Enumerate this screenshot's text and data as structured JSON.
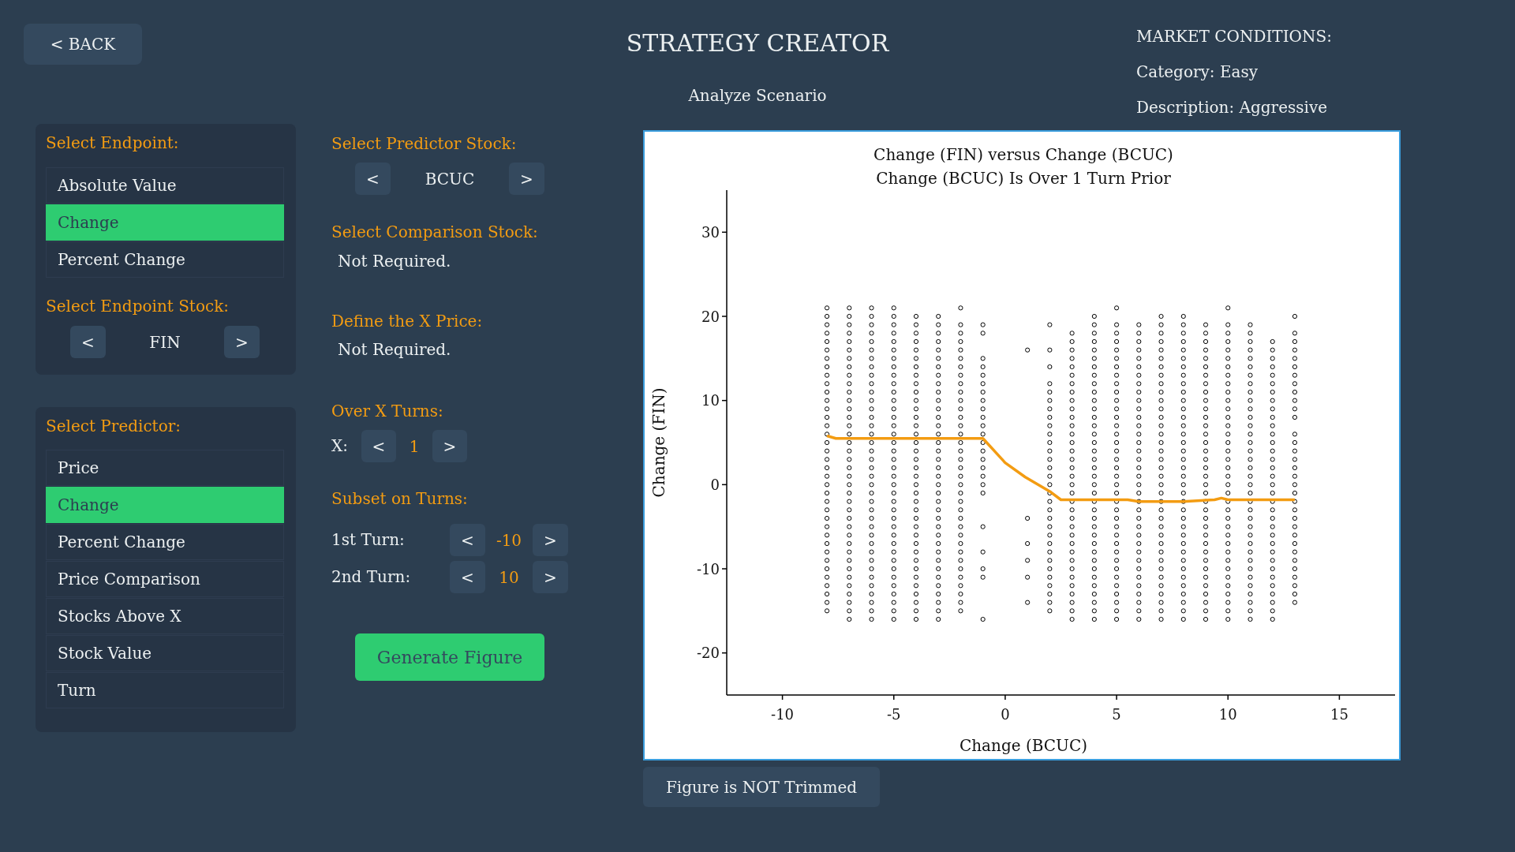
{
  "back_button": "< BACK",
  "header": {
    "title": "STRATEGY CREATOR",
    "subtitle": "Analyze Scenario"
  },
  "market_conditions": {
    "heading": "MARKET CONDITIONS:",
    "category": "Category: Easy",
    "description": "Description: Aggressive"
  },
  "endpoint_panel": {
    "heading": "Select Endpoint:",
    "options": [
      {
        "label": "Absolute Value",
        "selected": false
      },
      {
        "label": "Change",
        "selected": true
      },
      {
        "label": "Percent Change",
        "selected": false
      }
    ],
    "stock_heading": "Select Endpoint Stock:",
    "stock_stepper": {
      "prev": "<",
      "value": "FIN",
      "next": ">"
    }
  },
  "predictor_panel": {
    "heading": "Select Predictor:",
    "options": [
      {
        "label": "Price",
        "selected": false
      },
      {
        "label": "Change",
        "selected": true
      },
      {
        "label": "Percent Change",
        "selected": false
      },
      {
        "label": "Price Comparison",
        "selected": false
      },
      {
        "label": "Stocks Above X",
        "selected": false
      },
      {
        "label": "Stock Value",
        "selected": false
      },
      {
        "label": "Turn",
        "selected": false
      }
    ]
  },
  "predictor_stock": {
    "heading": "Select Predictor Stock:",
    "stepper": {
      "prev": "<",
      "value": "BCUC",
      "next": ">"
    }
  },
  "comparison_stock": {
    "heading": "Select Comparison Stock:",
    "note": "Not Required."
  },
  "x_price": {
    "heading": "Define the X Price:",
    "note": "Not Required."
  },
  "over_x_turns": {
    "heading": "Over X Turns:",
    "label": "X:",
    "stepper": {
      "prev": "<",
      "value": "1",
      "next": ">"
    }
  },
  "subset_on_turns": {
    "heading": "Subset on Turns:",
    "rows": [
      {
        "label": "1st Turn:",
        "stepper": {
          "prev": "<",
          "value": "-10",
          "next": ">"
        }
      },
      {
        "label": "2nd Turn:",
        "stepper": {
          "prev": "<",
          "value": "10",
          "next": ">"
        }
      }
    ]
  },
  "generate_button": "Generate Figure",
  "figure": {
    "chart_data": {
      "type": "scatter",
      "title": "Change (FIN) versus Change (BCUC)",
      "subtitle": "Change (BCUC) Is Over 1 Turn Prior",
      "xlabel": "Change (BCUC)",
      "ylabel": "Change (FIN)",
      "xlim": [
        -12.5,
        17.5
      ],
      "ylim": [
        -25,
        35
      ],
      "xticks": [
        -10,
        -5,
        0,
        5,
        10,
        15
      ],
      "yticks": [
        -20,
        -10,
        0,
        10,
        20,
        30
      ],
      "series": [
        {
          "type": "scatter",
          "color": "#000000",
          "x": [
            -8,
            -8,
            -8,
            -8,
            -8,
            -8,
            -8,
            -8,
            -8,
            -8,
            -8,
            -8,
            -8,
            -8,
            -8,
            -8,
            -8,
            -8,
            -8,
            -8,
            -8,
            -8,
            -8,
            -8,
            -8,
            -8,
            -8,
            -8,
            -8,
            -8,
            -8,
            -8,
            -8,
            -8,
            -8,
            -8,
            -8,
            -7,
            -7,
            -7,
            -7,
            -7,
            -7,
            -7,
            -7,
            -7,
            -7,
            -7,
            -7,
            -7,
            -7,
            -7,
            -7,
            -7,
            -7,
            -7,
            -7,
            -7,
            -7,
            -7,
            -7,
            -7,
            -7,
            -7,
            -7,
            -7,
            -7,
            -7,
            -7,
            -7,
            -7,
            -7,
            -7,
            -7,
            -7,
            -6,
            -6,
            -6,
            -6,
            -6,
            -6,
            -6,
            -6,
            -6,
            -6,
            -6,
            -6,
            -6,
            -6,
            -6,
            -6,
            -6,
            -6,
            -6,
            -6,
            -6,
            -6,
            -6,
            -6,
            -6,
            -6,
            -6,
            -6,
            -6,
            -6,
            -6,
            -6,
            -6,
            -6,
            -6,
            -6,
            -6,
            -6,
            -5,
            -5,
            -5,
            -5,
            -5,
            -5,
            -5,
            -5,
            -5,
            -5,
            -5,
            -5,
            -5,
            -5,
            -5,
            -5,
            -5,
            -5,
            -5,
            -5,
            -5,
            -5,
            -5,
            -5,
            -5,
            -5,
            -5,
            -5,
            -5,
            -5,
            -5,
            -5,
            -5,
            -5,
            -5,
            -5,
            -5,
            -5,
            -4,
            -4,
            -4,
            -4,
            -4,
            -4,
            -4,
            -4,
            -4,
            -4,
            -4,
            -4,
            -4,
            -4,
            -4,
            -4,
            -4,
            -4,
            -4,
            -4,
            -4,
            -4,
            -4,
            -4,
            -4,
            -4,
            -4,
            -4,
            -4,
            -4,
            -4,
            -4,
            -4,
            -4,
            -4,
            -4,
            -4,
            -3,
            -3,
            -3,
            -3,
            -3,
            -3,
            -3,
            -3,
            -3,
            -3,
            -3,
            -3,
            -3,
            -3,
            -3,
            -3,
            -3,
            -3,
            -3,
            -3,
            -3,
            -3,
            -3,
            -3,
            -3,
            -3,
            -3,
            -3,
            -3,
            -3,
            -3,
            -3,
            -3,
            -3,
            -3,
            -3,
            -3,
            -2,
            -2,
            -2,
            -2,
            -2,
            -2,
            -2,
            -2,
            -2,
            -2,
            -2,
            -2,
            -2,
            -2,
            -2,
            -2,
            -2,
            -2,
            -2,
            -2,
            -2,
            -2,
            -2,
            -2,
            -2,
            -2,
            -2,
            -2,
            -2,
            -2,
            -2,
            -2,
            -2,
            -2,
            -2,
            -2,
            -1,
            -1,
            -1,
            -1,
            -1,
            -1,
            -1,
            -1,
            -1,
            -1,
            -1,
            -1,
            -1,
            -1,
            -1,
            -1,
            -1,
            -1,
            -1,
            -1,
            -1,
            -1,
            -1,
            -1,
            1,
            1,
            1,
            1,
            1,
            1,
            2,
            2,
            2,
            2,
            2,
            2,
            2,
            2,
            2,
            2,
            2,
            2,
            2,
            2,
            2,
            2,
            2,
            2,
            2,
            2,
            2,
            2,
            2,
            2,
            2,
            2,
            2,
            2,
            2,
            2,
            2,
            3,
            3,
            3,
            3,
            3,
            3,
            3,
            3,
            3,
            3,
            3,
            3,
            3,
            3,
            3,
            3,
            3,
            3,
            3,
            3,
            3,
            3,
            3,
            3,
            3,
            3,
            3,
            3,
            3,
            3,
            3,
            3,
            3,
            3,
            3,
            4,
            4,
            4,
            4,
            4,
            4,
            4,
            4,
            4,
            4,
            4,
            4,
            4,
            4,
            4,
            4,
            4,
            4,
            4,
            4,
            4,
            4,
            4,
            4,
            4,
            4,
            4,
            4,
            4,
            4,
            4,
            4,
            4,
            4,
            4,
            4,
            4,
            5,
            5,
            5,
            5,
            5,
            5,
            5,
            5,
            5,
            5,
            5,
            5,
            5,
            5,
            5,
            5,
            5,
            5,
            5,
            5,
            5,
            5,
            5,
            5,
            5,
            5,
            5,
            5,
            5,
            5,
            5,
            5,
            5,
            5,
            5,
            5,
            5,
            6,
            6,
            6,
            6,
            6,
            6,
            6,
            6,
            6,
            6,
            6,
            6,
            6,
            6,
            6,
            6,
            6,
            6,
            6,
            6,
            6,
            6,
            6,
            6,
            6,
            6,
            6,
            6,
            6,
            6,
            6,
            6,
            6,
            6,
            6,
            6,
            7,
            7,
            7,
            7,
            7,
            7,
            7,
            7,
            7,
            7,
            7,
            7,
            7,
            7,
            7,
            7,
            7,
            7,
            7,
            7,
            7,
            7,
            7,
            7,
            7,
            7,
            7,
            7,
            7,
            7,
            7,
            7,
            7,
            7,
            7,
            7,
            7,
            8,
            8,
            8,
            8,
            8,
            8,
            8,
            8,
            8,
            8,
            8,
            8,
            8,
            8,
            8,
            8,
            8,
            8,
            8,
            8,
            8,
            8,
            8,
            8,
            8,
            8,
            8,
            8,
            8,
            8,
            8,
            8,
            8,
            8,
            8,
            8,
            8,
            9,
            9,
            9,
            9,
            9,
            9,
            9,
            9,
            9,
            9,
            9,
            9,
            9,
            9,
            9,
            9,
            9,
            9,
            9,
            9,
            9,
            9,
            9,
            9,
            9,
            9,
            9,
            9,
            9,
            9,
            9,
            9,
            9,
            9,
            9,
            9,
            10,
            10,
            10,
            10,
            10,
            10,
            10,
            10,
            10,
            10,
            10,
            10,
            10,
            10,
            10,
            10,
            10,
            10,
            10,
            10,
            10,
            10,
            10,
            10,
            10,
            10,
            10,
            10,
            10,
            10,
            10,
            10,
            10,
            10,
            10,
            10,
            10,
            11,
            11,
            11,
            11,
            11,
            11,
            11,
            11,
            11,
            11,
            11,
            11,
            11,
            11,
            11,
            11,
            11,
            11,
            11,
            11,
            11,
            11,
            11,
            11,
            11,
            11,
            11,
            11,
            11,
            11,
            11,
            11,
            11,
            11,
            11,
            11,
            12,
            12,
            12,
            12,
            12,
            12,
            12,
            12,
            12,
            12,
            12,
            12,
            12,
            12,
            12,
            12,
            12,
            12,
            12,
            12,
            12,
            12,
            12,
            12,
            12,
            12,
            12,
            12,
            12,
            12,
            12,
            12,
            12,
            12,
            13,
            13,
            13,
            13,
            13,
            13,
            13,
            13,
            13,
            13,
            13,
            13,
            13,
            13,
            13,
            13,
            13,
            13,
            13,
            13,
            13,
            13,
            13,
            13,
            13,
            13,
            13,
            13,
            13,
            13,
            13,
            13,
            13
          ],
          "values": [
            21,
            20,
            19,
            18,
            17,
            16,
            15,
            14,
            13,
            12,
            11,
            10,
            9,
            8,
            7,
            6,
            5,
            4,
            3,
            2,
            1,
            0,
            -1,
            -2,
            -3,
            -4,
            -5,
            -6,
            -7,
            -8,
            -9,
            -10,
            -11,
            -12,
            -13,
            -14,
            -15,
            21,
            20,
            19,
            18,
            17,
            16,
            15,
            14,
            13,
            12,
            11,
            10,
            9,
            8,
            7,
            6,
            5,
            4,
            3,
            2,
            1,
            0,
            -1,
            -2,
            -3,
            -4,
            -5,
            -6,
            -7,
            -8,
            -9,
            -10,
            -11,
            -12,
            -13,
            -14,
            -15,
            -16,
            21,
            20,
            19,
            18,
            17,
            16,
            15,
            14,
            13,
            12,
            11,
            10,
            9,
            8,
            7,
            6,
            5,
            4,
            3,
            2,
            1,
            0,
            -1,
            -2,
            -3,
            -4,
            -5,
            -6,
            -7,
            -8,
            -9,
            -10,
            -11,
            -12,
            -13,
            -14,
            -15,
            -16,
            21,
            20,
            19,
            18,
            17,
            16,
            15,
            14,
            13,
            12,
            11,
            10,
            9,
            8,
            7,
            6,
            5,
            4,
            3,
            2,
            1,
            0,
            -1,
            -2,
            -3,
            -4,
            -5,
            -6,
            -7,
            -8,
            -9,
            -10,
            -11,
            -12,
            -13,
            -14,
            -15,
            -16,
            20,
            19,
            18,
            17,
            16,
            15,
            14,
            13,
            12,
            11,
            10,
            9,
            8,
            7,
            6,
            5,
            4,
            3,
            2,
            1,
            0,
            -1,
            -2,
            -3,
            -4,
            -5,
            -6,
            -7,
            -8,
            -9,
            -10,
            -11,
            -12,
            -13,
            -14,
            -15,
            -16,
            20,
            19,
            18,
            17,
            16,
            15,
            14,
            13,
            12,
            11,
            10,
            9,
            8,
            7,
            6,
            5,
            4,
            3,
            2,
            1,
            0,
            -1,
            -2,
            -3,
            -4,
            -5,
            -6,
            -7,
            -8,
            -9,
            -10,
            -11,
            -12,
            -13,
            -14,
            -15,
            -16,
            21,
            19,
            18,
            17,
            16,
            15,
            14,
            13,
            12,
            11,
            10,
            9,
            8,
            7,
            6,
            5,
            4,
            3,
            2,
            1,
            0,
            -1,
            -2,
            -3,
            -4,
            -5,
            -6,
            -7,
            -8,
            -9,
            -10,
            -11,
            -12,
            -13,
            -14,
            -15,
            19,
            18,
            15,
            14,
            13,
            12,
            11,
            10,
            9,
            8,
            7,
            6,
            5,
            4,
            3,
            2,
            1,
            0,
            -1,
            -5,
            -8,
            -10,
            -11,
            -16,
            16,
            -4,
            -7,
            -9,
            -11,
            -14,
            19,
            16,
            14,
            12,
            11,
            10,
            9,
            8,
            7,
            6,
            5,
            4,
            3,
            2,
            1,
            0,
            -1,
            -2,
            -3,
            -4,
            -5,
            -6,
            -7,
            -8,
            -9,
            -10,
            -11,
            -12,
            -13,
            -14,
            -15,
            18,
            17,
            16,
            15,
            14,
            13,
            12,
            11,
            10,
            9,
            8,
            7,
            6,
            5,
            4,
            3,
            2,
            1,
            0,
            -1,
            -2,
            -3,
            -4,
            -5,
            -6,
            -7,
            -8,
            -9,
            -10,
            -11,
            -12,
            -13,
            -14,
            -15,
            -16,
            20,
            19,
            18,
            17,
            16,
            15,
            14,
            13,
            12,
            11,
            10,
            9,
            8,
            7,
            6,
            5,
            4,
            3,
            2,
            1,
            0,
            -1,
            -2,
            -3,
            -4,
            -5,
            -6,
            -7,
            -8,
            -9,
            -10,
            -11,
            -12,
            -13,
            -14,
            -15,
            -16,
            21,
            19,
            18,
            17,
            16,
            15,
            14,
            13,
            12,
            11,
            10,
            9,
            8,
            7,
            6,
            5,
            4,
            3,
            2,
            1,
            0,
            -1,
            -2,
            -3,
            -4,
            -5,
            -6,
            -7,
            -8,
            -9,
            -10,
            -11,
            -12,
            -13,
            -14,
            -15,
            -16,
            19,
            18,
            17,
            16,
            15,
            14,
            13,
            12,
            11,
            10,
            9,
            8,
            7,
            6,
            5,
            4,
            3,
            2,
            1,
            0,
            -1,
            -2,
            -3,
            -4,
            -5,
            -6,
            -7,
            -8,
            -9,
            -10,
            -11,
            -12,
            -13,
            -14,
            -15,
            -16,
            20,
            19,
            18,
            17,
            16,
            15,
            14,
            13,
            12,
            11,
            10,
            9,
            8,
            7,
            6,
            5,
            4,
            3,
            2,
            1,
            0,
            -1,
            -2,
            -3,
            -4,
            -5,
            -6,
            -7,
            -8,
            -9,
            -10,
            -11,
            -12,
            -13,
            -14,
            -15,
            -16,
            20,
            19,
            18,
            17,
            16,
            15,
            14,
            13,
            12,
            11,
            10,
            9,
            8,
            7,
            6,
            5,
            4,
            3,
            2,
            1,
            0,
            -1,
            -2,
            -3,
            -4,
            -5,
            -6,
            -7,
            -8,
            -9,
            -10,
            -11,
            -12,
            -13,
            -14,
            -15,
            -16,
            19,
            18,
            17,
            16,
            15,
            14,
            13,
            12,
            11,
            10,
            9,
            8,
            7,
            6,
            5,
            4,
            3,
            2,
            1,
            0,
            -1,
            -2,
            -3,
            -4,
            -5,
            -6,
            -7,
            -8,
            -9,
            -10,
            -11,
            -12,
            -13,
            -14,
            -15,
            -16,
            21,
            19,
            18,
            17,
            16,
            15,
            14,
            13,
            12,
            11,
            10,
            9,
            8,
            7,
            6,
            5,
            4,
            3,
            2,
            1,
            0,
            -1,
            -2,
            -3,
            -4,
            -5,
            -6,
            -7,
            -8,
            -9,
            -10,
            -11,
            -12,
            -13,
            -14,
            -15,
            -16,
            19,
            18,
            17,
            16,
            15,
            14,
            13,
            12,
            11,
            10,
            9,
            8,
            7,
            6,
            5,
            4,
            3,
            2,
            1,
            0,
            -1,
            -2,
            -3,
            -4,
            -5,
            -6,
            -7,
            -8,
            -9,
            -10,
            -11,
            -12,
            -13,
            -14,
            -15,
            -16,
            17,
            16,
            15,
            14,
            13,
            12,
            11,
            10,
            9,
            8,
            7,
            6,
            5,
            4,
            3,
            2,
            1,
            0,
            -1,
            -2,
            -3,
            -4,
            -5,
            -6,
            -7,
            -8,
            -9,
            -10,
            -11,
            -12,
            -13,
            -14,
            -15,
            -16,
            20,
            18,
            17,
            16,
            15,
            14,
            13,
            12,
            11,
            10,
            9,
            8,
            6,
            5,
            4,
            3,
            2,
            1,
            0,
            -1,
            -2,
            -3,
            -4,
            -5,
            -6,
            -7,
            -8,
            -9,
            -10,
            -11,
            -12,
            -13,
            -14
          ]
        },
        {
          "type": "line",
          "color": "#f39c12",
          "x": [
            -8,
            -7.6,
            -1,
            0,
            0.9,
            2,
            2.5,
            5.5,
            6,
            8,
            9.4,
            9.7,
            10,
            13
          ],
          "values": [
            5.8,
            5.5,
            5.5,
            2.6,
            0.9,
            -0.8,
            -1.8,
            -1.8,
            -2,
            -2,
            -1.8,
            -1.6,
            -1.8,
            -1.8
          ]
        }
      ]
    },
    "trim_button": "Figure is NOT Trimmed"
  }
}
